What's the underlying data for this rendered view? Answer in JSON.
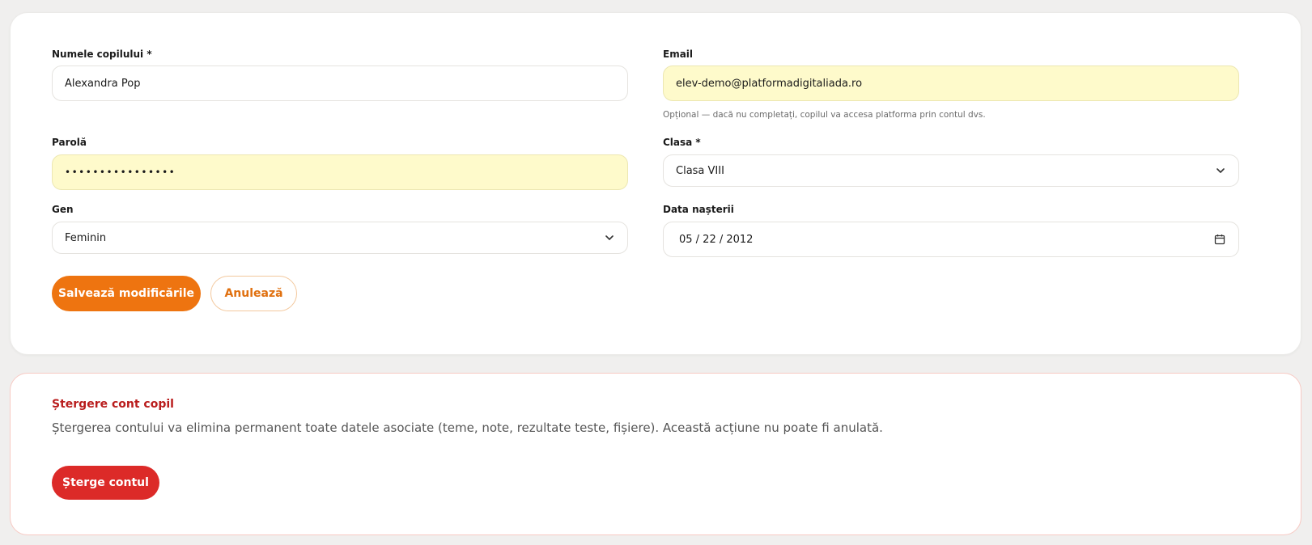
{
  "form": {
    "child_name": {
      "label": "Numele copilului *",
      "value": "Alexandra Pop"
    },
    "email": {
      "label": "Email",
      "value": "elev-demo@platformadigitaliada.ro",
      "hint": "Opțional — dacă nu completați, copilul va accesa platforma prin contul dvs."
    },
    "password": {
      "label": "Parolă",
      "value": "••••••••••••••••"
    },
    "class": {
      "label": "Clasa *",
      "value": "Clasa VIII"
    },
    "gender": {
      "label": "Gen",
      "value": "Feminin"
    },
    "birth_date": {
      "label": "Data nașterii",
      "value": "05 / 22 / 2012"
    },
    "save_label": "Salvează modificările",
    "cancel_label": "Anulează"
  },
  "danger_zone": {
    "title": "Ștergere cont copil",
    "description": "Ștergerea contului va elimina permanent toate datele asociate (teme, note, rezultate teste, fișiere). Această acțiune nu poate fi anulată.",
    "delete_label": "Șterge contul"
  },
  "colors": {
    "primary": "#ee7410",
    "danger": "#dc2a28",
    "autofill": "#fefacb",
    "background": "#f0efee"
  },
  "icons": {
    "select": "chevron-down-icon",
    "date": "calendar-icon"
  }
}
